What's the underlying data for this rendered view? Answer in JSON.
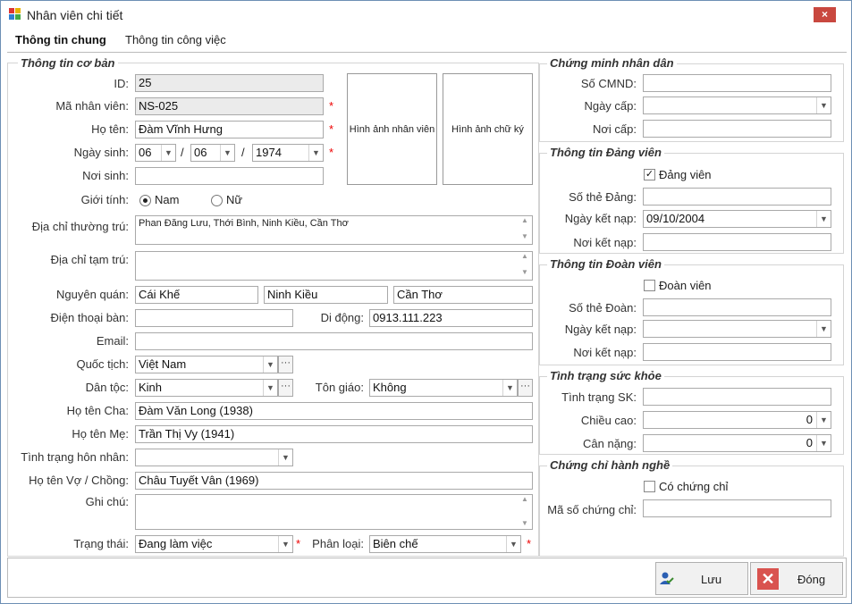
{
  "window": {
    "title": "Nhân viên chi tiết",
    "close": "×"
  },
  "tabs": [
    "Thông tin chung",
    "Thông tin công việc"
  ],
  "basic": {
    "title": "Thông tin cơ bản",
    "id_label": "ID:",
    "id_value": "25",
    "code_label": "Mã nhân viên:",
    "code_value": "NS-025",
    "name_label": "Họ tên:",
    "name_value": "Đàm Vĩnh Hưng",
    "dob_label": "Ngày sinh:",
    "dob_day": "06",
    "dob_month": "06",
    "dob_year": "1974",
    "sep": "/",
    "birthplace_label": "Nơi sinh:",
    "birthplace_value": "",
    "gender_label": "Giới tính:",
    "gender_male": "Nam",
    "gender_female": "Nữ",
    "photo_label": "Hình ảnh nhân viên",
    "signature_label": "Hình ảnh chữ ký",
    "permanent_label": "Địa chỉ thường trú:",
    "permanent_value": "Phan Đăng Lưu, Thới Bình, Ninh Kiều, Cần Thơ",
    "temp_label": "Địa chỉ tạm trú:",
    "temp_value": "",
    "origin_label": "Nguyên quán:",
    "origin_1": "Cái Khế",
    "origin_2": "Ninh Kiều",
    "origin_3": "Cần Thơ",
    "phone_label": "Điện thoại bàn:",
    "phone_value": "",
    "mobile_label": "Di động:",
    "mobile_value": "0913.111.223",
    "email_label": "Email:",
    "email_value": "",
    "nationality_label": "Quốc tịch:",
    "nationality_value": "Việt Nam",
    "ethnic_label": "Dân tộc:",
    "ethnic_value": "Kinh",
    "religion_label": "Tôn giáo:",
    "religion_value": "Không",
    "father_label": "Họ tên Cha:",
    "father_value": "Đàm Văn Long (1938)",
    "mother_label": "Họ tên Mẹ:",
    "mother_value": "Trần Thị Vy (1941)",
    "marital_label": "Tình trạng hôn nhân:",
    "marital_value": "",
    "spouse_label": "Họ tên Vợ / Chồng:",
    "spouse_value": "Châu Tuyết Vân (1969)",
    "note_label": "Ghi chú:",
    "note_value": "",
    "status_label": "Trạng thái:",
    "status_value": "Đang làm việc",
    "category_label": "Phân loại:",
    "category_value": "Biên chế",
    "required": "*",
    "more": "···"
  },
  "idcard": {
    "title": "Chứng minh nhân dân",
    "number_label": "Số CMND:",
    "number_value": "",
    "date_label": "Ngày cấp:",
    "date_value": "",
    "place_label": "Nơi cấp:",
    "place_value": ""
  },
  "party": {
    "title": "Thông tin Đảng viên",
    "check_label": "Đảng viên",
    "card_label": "Số thẻ Đảng:",
    "card_value": "",
    "date_label": "Ngày kết nạp:",
    "date_value": "09/10/2004",
    "place_label": "Nơi kết nạp:",
    "place_value": ""
  },
  "union": {
    "title": "Thông tin Đoàn viên",
    "check_label": "Đoàn viên",
    "card_label": "Số thẻ Đoàn:",
    "card_value": "",
    "date_label": "Ngày kết nạp:",
    "date_value": "",
    "place_label": "Nơi kết nạp:",
    "place_value": ""
  },
  "health": {
    "title": "Tình trạng sức khỏe",
    "status_label": "Tình trạng SK:",
    "status_value": "",
    "height_label": "Chiều cao:",
    "height_value": "0",
    "weight_label": "Cân nặng:",
    "weight_value": "0"
  },
  "cert": {
    "title": "Chứng chỉ hành nghề",
    "check_label": "Có chứng chỉ",
    "code_label": "Mã số chứng chỉ:",
    "code_value": ""
  },
  "buttons": {
    "save": "Lưu",
    "close": "Đóng"
  },
  "colors": {
    "accent": "#6d8fb4",
    "close_bg": "#c9483f",
    "required": "#ee0000"
  }
}
